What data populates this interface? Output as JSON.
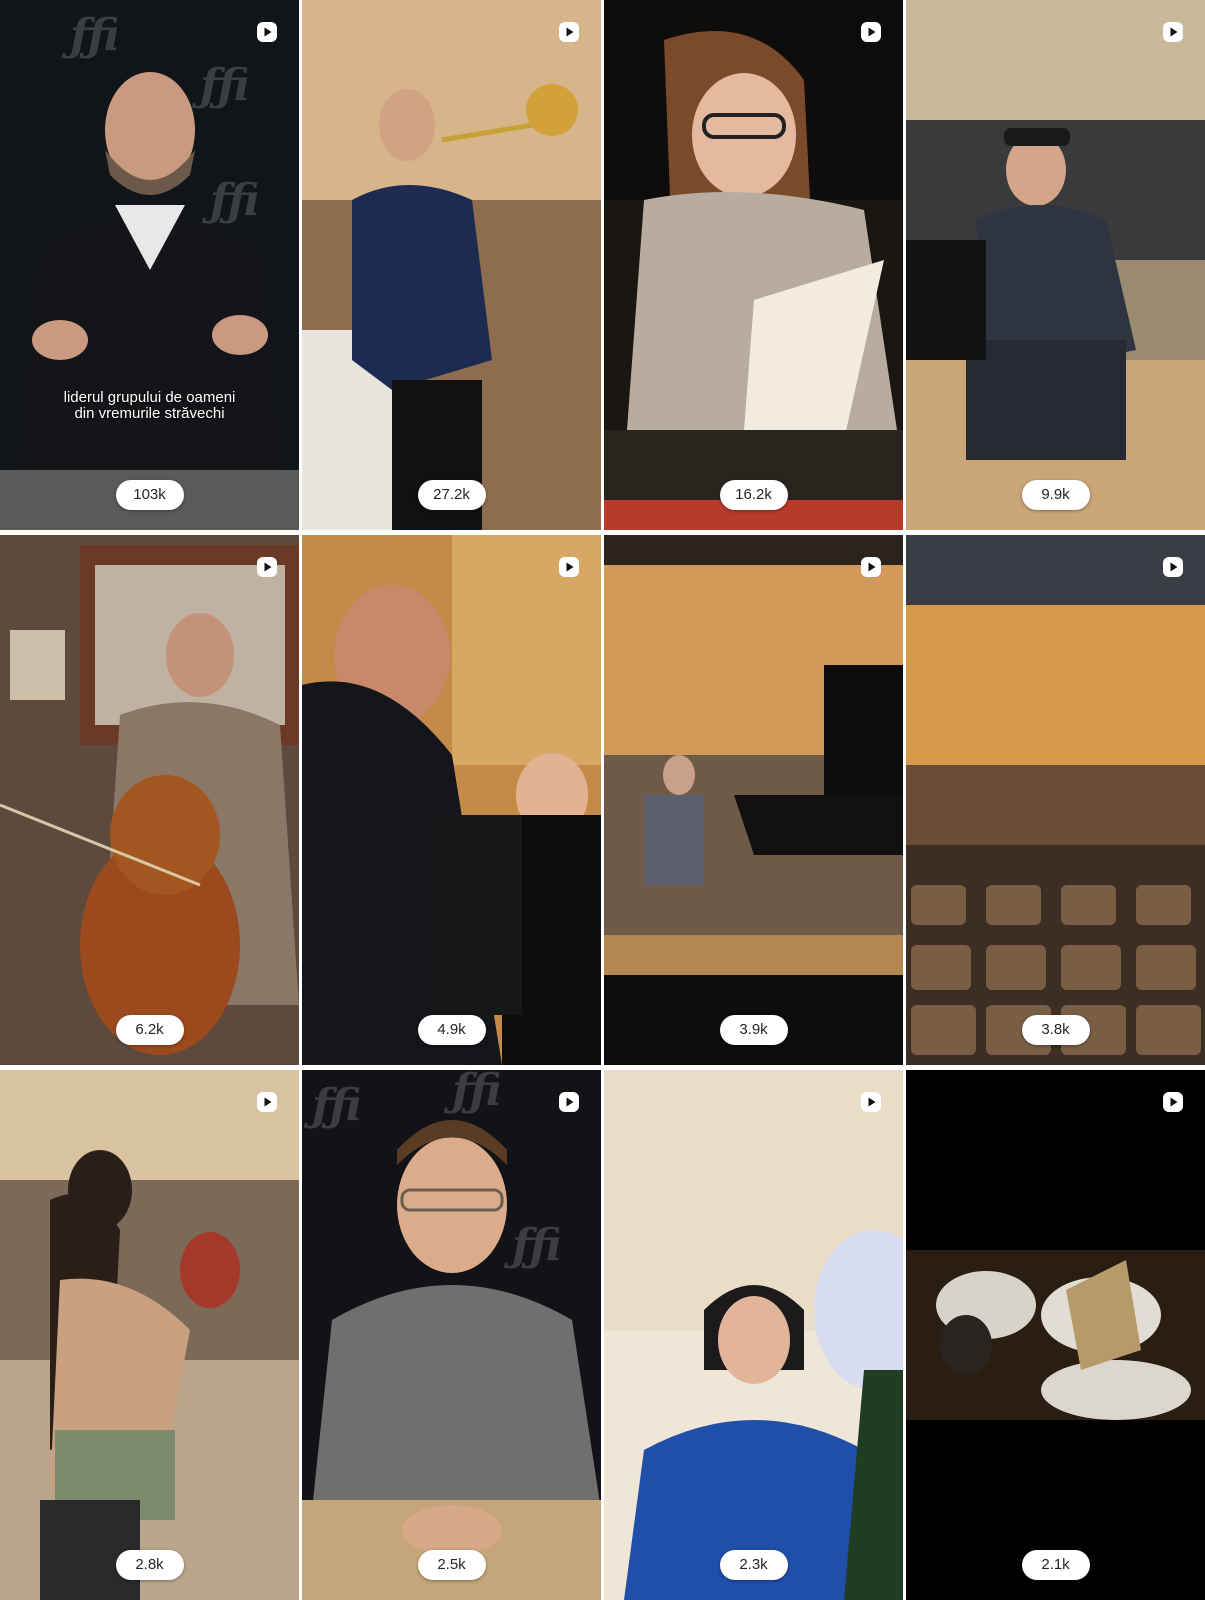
{
  "reels": [
    {
      "views": "103k",
      "caption": [
        "liderul grupului de oameni",
        "din vremurile străvechi"
      ],
      "icon": "reel-icon"
    },
    {
      "views": "27.2k",
      "icon": "reel-icon"
    },
    {
      "views": "16.2k",
      "icon": "reel-icon"
    },
    {
      "views": "9.9k",
      "icon": "reel-icon"
    },
    {
      "views": "6.2k",
      "icon": "reel-icon"
    },
    {
      "views": "4.9k",
      "icon": "reel-icon"
    },
    {
      "views": "3.9k",
      "icon": "reel-icon"
    },
    {
      "views": "3.8k",
      "icon": "reel-icon"
    },
    {
      "views": "2.8k",
      "icon": "reel-icon"
    },
    {
      "views": "2.5k",
      "icon": "reel-icon"
    },
    {
      "views": "2.3k",
      "icon": "reel-icon"
    },
    {
      "views": "2.1k",
      "icon": "reel-icon"
    }
  ],
  "colors": {
    "badge_bg": "#ffffff",
    "badge_text": "#262626",
    "icon": "#ffffff"
  }
}
